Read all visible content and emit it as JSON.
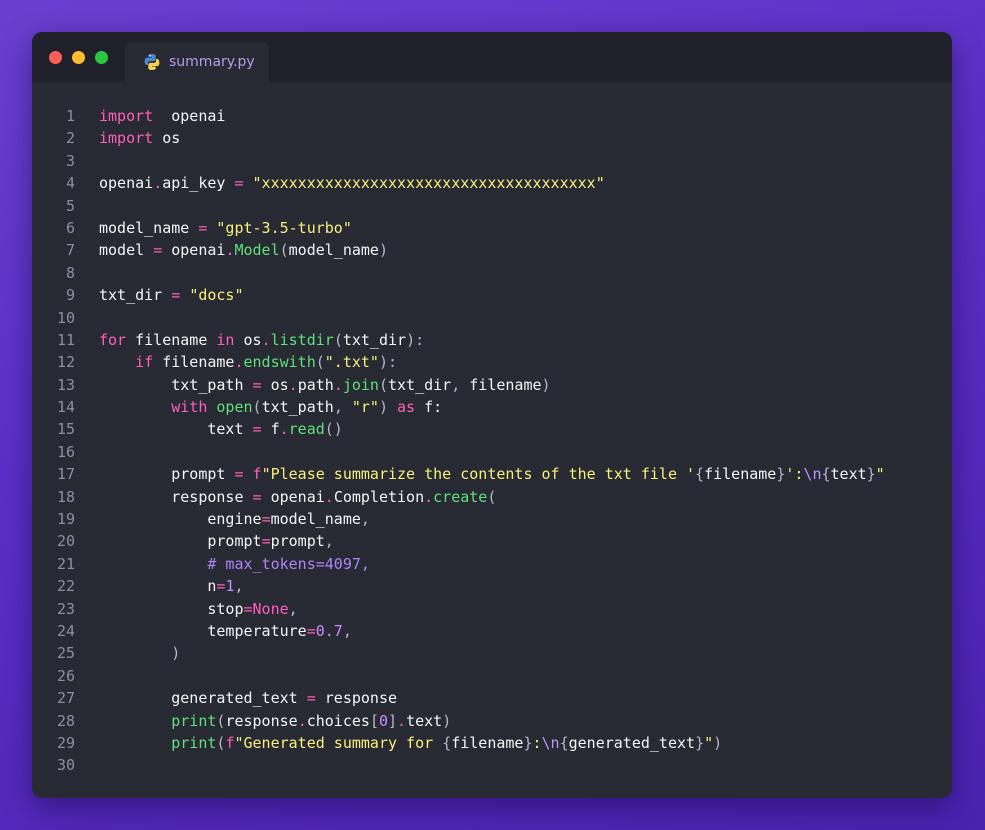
{
  "window": {
    "tab_label": "summary.py",
    "tab_icon": "python-icon",
    "colors": {
      "background": "#272933",
      "titlebar": "#1f2029",
      "keyword": "#ff5fb7",
      "string": "#f7ef7a",
      "function": "#5fe07a",
      "number": "#c590ff",
      "comment": "#b083f7",
      "text": "#f4f4f6"
    }
  },
  "editor": {
    "language": "python",
    "lines": [
      {
        "n": "1",
        "t": [
          [
            "kw",
            "import"
          ],
          [
            "",
            "  openai"
          ]
        ]
      },
      {
        "n": "2",
        "t": [
          [
            "kw",
            "import"
          ],
          [
            "",
            " os"
          ]
        ]
      },
      {
        "n": "3",
        "t": []
      },
      {
        "n": "4",
        "t": [
          [
            "",
            "openai"
          ],
          [
            "op",
            "."
          ],
          [
            "",
            "api_key "
          ],
          [
            "op",
            "="
          ],
          [
            "",
            " "
          ],
          [
            "str",
            "\"xxxxxxxxxxxxxxxxxxxxxxxxxxxxxxxxxxxxx\""
          ]
        ]
      },
      {
        "n": "5",
        "t": []
      },
      {
        "n": "6",
        "t": [
          [
            "",
            "model_name "
          ],
          [
            "op",
            "="
          ],
          [
            "",
            " "
          ],
          [
            "str",
            "\"gpt-3.5-turbo\""
          ]
        ]
      },
      {
        "n": "7",
        "t": [
          [
            "",
            "model "
          ],
          [
            "op",
            "="
          ],
          [
            "",
            " openai"
          ],
          [
            "op",
            "."
          ],
          [
            "fn",
            "Model"
          ],
          [
            "pn",
            "("
          ],
          [
            "",
            "model_name"
          ],
          [
            "pn",
            ")"
          ]
        ]
      },
      {
        "n": "8",
        "t": []
      },
      {
        "n": "9",
        "t": [
          [
            "",
            "txt_dir "
          ],
          [
            "op",
            "="
          ],
          [
            "",
            " "
          ],
          [
            "str",
            "\"docs\""
          ]
        ]
      },
      {
        "n": "10",
        "t": []
      },
      {
        "n": "11",
        "t": [
          [
            "kw",
            "for"
          ],
          [
            "",
            " filename "
          ],
          [
            "kw",
            "in"
          ],
          [
            "",
            " os"
          ],
          [
            "op",
            "."
          ],
          [
            "fn",
            "listdir"
          ],
          [
            "pn",
            "("
          ],
          [
            "",
            "txt_dir"
          ],
          [
            "pn",
            "):"
          ]
        ]
      },
      {
        "n": "12",
        "t": [
          [
            "",
            "    "
          ],
          [
            "kw",
            "if"
          ],
          [
            "",
            " filename"
          ],
          [
            "op",
            "."
          ],
          [
            "fn",
            "endswith"
          ],
          [
            "pn",
            "("
          ],
          [
            "str",
            "\".txt\""
          ],
          [
            "pn",
            "):"
          ]
        ]
      },
      {
        "n": "13",
        "t": [
          [
            "",
            "        txt_path "
          ],
          [
            "op",
            "="
          ],
          [
            "",
            " os"
          ],
          [
            "op",
            "."
          ],
          [
            "",
            "path"
          ],
          [
            "op",
            "."
          ],
          [
            "fn",
            "join"
          ],
          [
            "pn",
            "("
          ],
          [
            "",
            "txt_dir"
          ],
          [
            "pn",
            ","
          ],
          [
            "",
            " filename"
          ],
          [
            "pn",
            ")"
          ]
        ]
      },
      {
        "n": "14",
        "t": [
          [
            "",
            "        "
          ],
          [
            "kw",
            "with"
          ],
          [
            "",
            " "
          ],
          [
            "fn",
            "open"
          ],
          [
            "pn",
            "("
          ],
          [
            "",
            "txt_path"
          ],
          [
            "pn",
            ","
          ],
          [
            "",
            " "
          ],
          [
            "str",
            "\"r\""
          ],
          [
            "pn",
            ")"
          ],
          [
            "",
            " "
          ],
          [
            "kw",
            "as"
          ],
          [
            "",
            " f:"
          ]
        ]
      },
      {
        "n": "15",
        "t": [
          [
            "",
            "            text "
          ],
          [
            "op",
            "="
          ],
          [
            "",
            " f"
          ],
          [
            "op",
            "."
          ],
          [
            "fn",
            "read"
          ],
          [
            "pn",
            "()"
          ]
        ]
      },
      {
        "n": "16",
        "t": []
      },
      {
        "n": "17",
        "t": [
          [
            "",
            "        prompt "
          ],
          [
            "op",
            "="
          ],
          [
            "",
            " "
          ],
          [
            "kw",
            "f"
          ],
          [
            "str",
            "\"Please summarize the contents of the txt file '"
          ],
          [
            "pn",
            "{"
          ],
          [
            "",
            "filename"
          ],
          [
            "pn",
            "}"
          ],
          [
            "str",
            "':"
          ],
          [
            "esc",
            "\\n"
          ],
          [
            "pn",
            "{"
          ],
          [
            "",
            "text"
          ],
          [
            "pn",
            "}"
          ],
          [
            "str",
            "\""
          ]
        ]
      },
      {
        "n": "18",
        "t": [
          [
            "",
            "        response "
          ],
          [
            "op",
            "="
          ],
          [
            "",
            " openai"
          ],
          [
            "op",
            "."
          ],
          [
            "",
            "Completion"
          ],
          [
            "op",
            "."
          ],
          [
            "fn",
            "create"
          ],
          [
            "pn",
            "("
          ]
        ]
      },
      {
        "n": "19",
        "t": [
          [
            "",
            "            engine"
          ],
          [
            "op",
            "="
          ],
          [
            "",
            "model_name"
          ],
          [
            "pn",
            ","
          ]
        ]
      },
      {
        "n": "20",
        "t": [
          [
            "",
            "            prompt"
          ],
          [
            "op",
            "="
          ],
          [
            "",
            "prompt"
          ],
          [
            "pn",
            ","
          ]
        ]
      },
      {
        "n": "21",
        "t": [
          [
            "",
            "            "
          ],
          [
            "cm",
            "# max_tokens=4097,"
          ]
        ]
      },
      {
        "n": "22",
        "t": [
          [
            "",
            "            n"
          ],
          [
            "op",
            "="
          ],
          [
            "num",
            "1"
          ],
          [
            "pn",
            ","
          ]
        ]
      },
      {
        "n": "23",
        "t": [
          [
            "",
            "            stop"
          ],
          [
            "op",
            "="
          ],
          [
            "kw",
            "None"
          ],
          [
            "pn",
            ","
          ]
        ]
      },
      {
        "n": "24",
        "t": [
          [
            "",
            "            temperature"
          ],
          [
            "op",
            "="
          ],
          [
            "num",
            "0.7"
          ],
          [
            "pn",
            ","
          ]
        ]
      },
      {
        "n": "25",
        "t": [
          [
            "",
            "        "
          ],
          [
            "pn",
            ")"
          ]
        ]
      },
      {
        "n": "26",
        "t": []
      },
      {
        "n": "27",
        "t": [
          [
            "",
            "        generated_text "
          ],
          [
            "op",
            "="
          ],
          [
            "",
            " response"
          ]
        ]
      },
      {
        "n": "28",
        "t": [
          [
            "",
            "        "
          ],
          [
            "fn",
            "print"
          ],
          [
            "pn",
            "("
          ],
          [
            "",
            "response"
          ],
          [
            "op",
            "."
          ],
          [
            "",
            "choices"
          ],
          [
            "pn",
            "["
          ],
          [
            "num",
            "0"
          ],
          [
            "pn",
            "]"
          ],
          [
            "op",
            "."
          ],
          [
            "",
            "text"
          ],
          [
            "pn",
            ")"
          ]
        ]
      },
      {
        "n": "29",
        "t": [
          [
            "",
            "        "
          ],
          [
            "fn",
            "print"
          ],
          [
            "pn",
            "("
          ],
          [
            "kw",
            "f"
          ],
          [
            "str",
            "\"Generated summary for "
          ],
          [
            "pn",
            "{"
          ],
          [
            "",
            "filename"
          ],
          [
            "pn",
            "}"
          ],
          [
            "str",
            ":"
          ],
          [
            "esc",
            "\\n"
          ],
          [
            "pn",
            "{"
          ],
          [
            "",
            "generated_text"
          ],
          [
            "pn",
            "}"
          ],
          [
            "str",
            "\""
          ],
          [
            "pn",
            ")"
          ]
        ]
      },
      {
        "n": "30",
        "t": []
      }
    ]
  }
}
